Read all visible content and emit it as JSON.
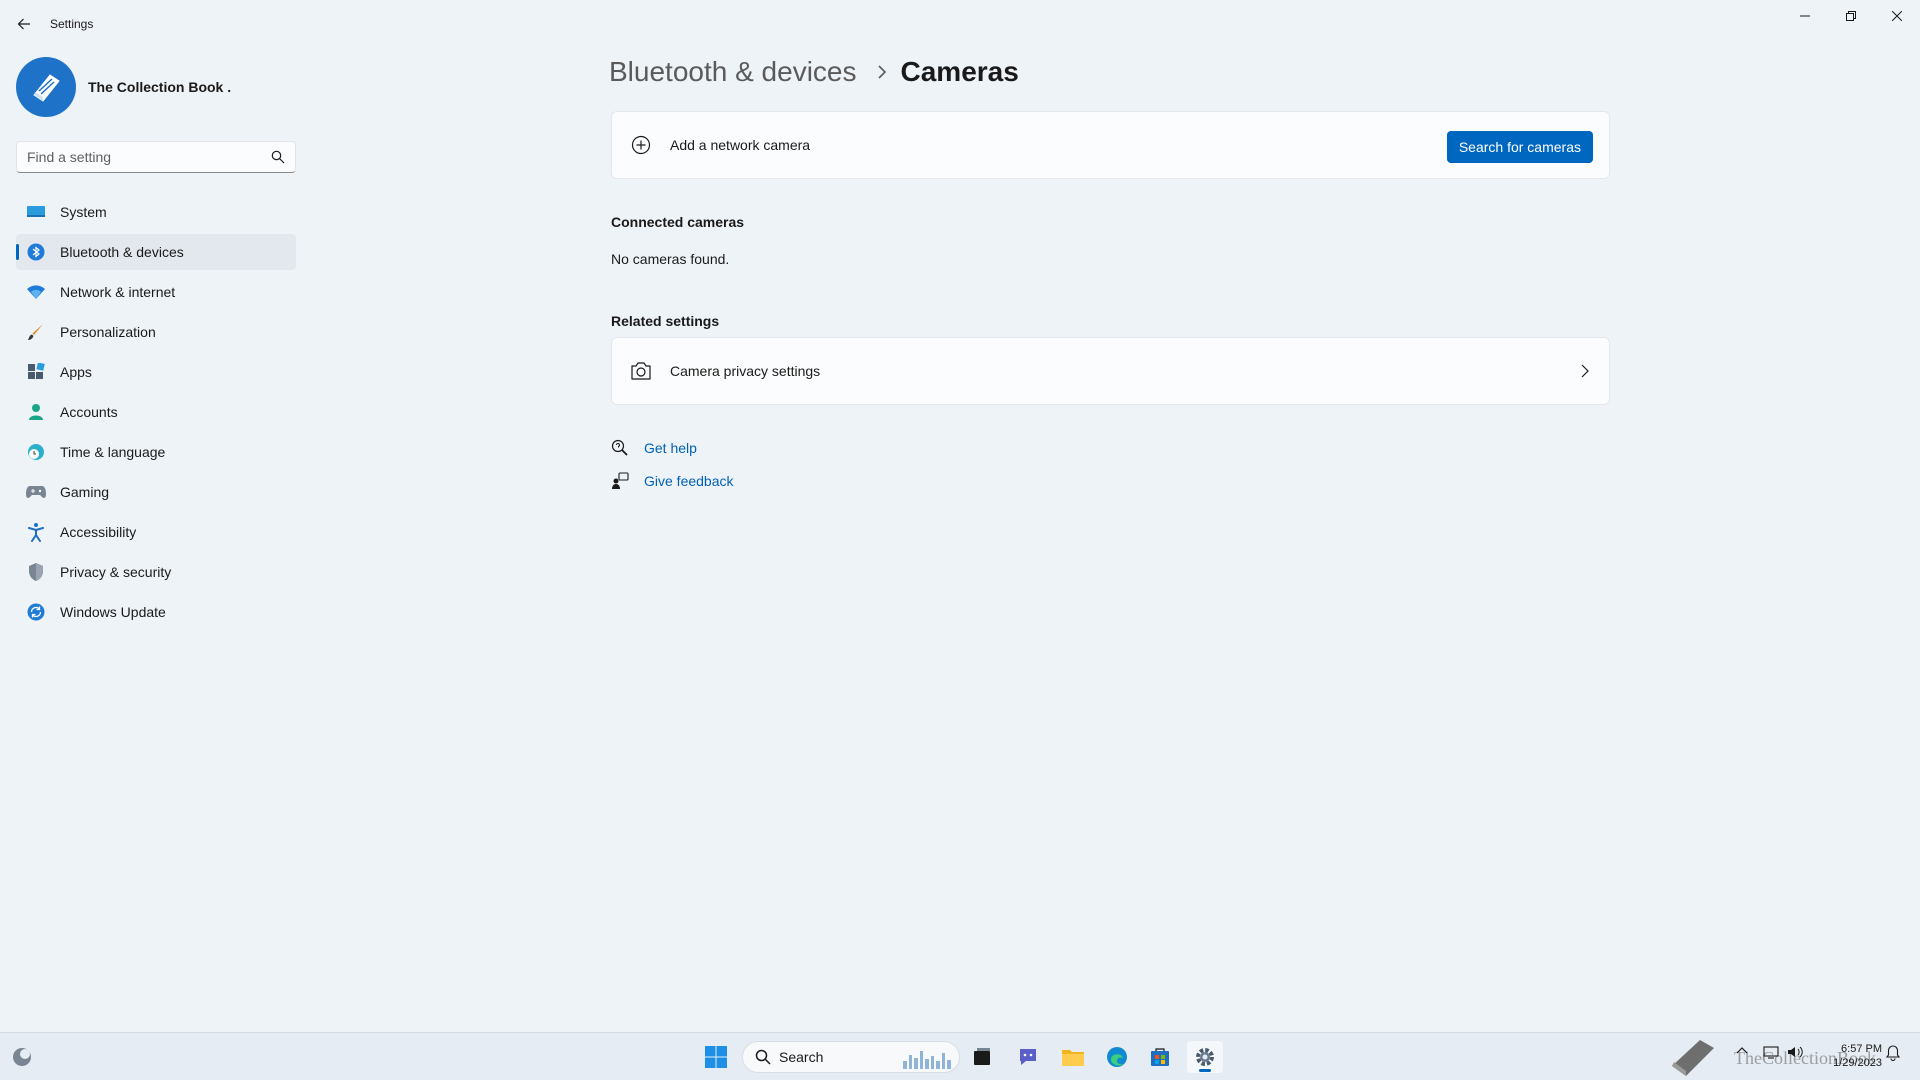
{
  "window": {
    "title": "Settings"
  },
  "profile": {
    "name": "The Collection Book ."
  },
  "search": {
    "placeholder": "Find a setting"
  },
  "sidebar": {
    "items": [
      {
        "label": "System",
        "icon": "monitor-icon"
      },
      {
        "label": "Bluetooth & devices",
        "icon": "bluetooth-icon",
        "active": true
      },
      {
        "label": "Network & internet",
        "icon": "wifi-icon"
      },
      {
        "label": "Personalization",
        "icon": "brush-icon"
      },
      {
        "label": "Apps",
        "icon": "apps-icon"
      },
      {
        "label": "Accounts",
        "icon": "person-icon"
      },
      {
        "label": "Time & language",
        "icon": "globe-clock-icon"
      },
      {
        "label": "Gaming",
        "icon": "gamepad-icon"
      },
      {
        "label": "Accessibility",
        "icon": "accessibility-icon"
      },
      {
        "label": "Privacy & security",
        "icon": "shield-icon"
      },
      {
        "label": "Windows Update",
        "icon": "update-icon"
      }
    ]
  },
  "breadcrumb": {
    "parent": "Bluetooth & devices",
    "current": "Cameras"
  },
  "add_camera": {
    "label": "Add a network camera",
    "button": "Search for cameras"
  },
  "connected": {
    "heading": "Connected cameras",
    "empty": "No cameras found."
  },
  "related": {
    "heading": "Related settings",
    "privacy_label": "Camera privacy settings"
  },
  "help": {
    "get_help": "Get help",
    "give_feedback": "Give feedback"
  },
  "taskbar": {
    "search_label": "Search",
    "time": "6:57 PM",
    "date": "1/29/2023",
    "watermark": "TheCollectionBook"
  },
  "colors": {
    "accent": "#0067c0",
    "link": "#0060b8",
    "background": "#eef3f8"
  }
}
